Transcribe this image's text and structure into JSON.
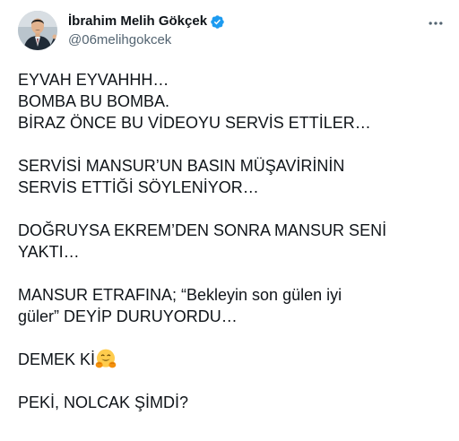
{
  "author": {
    "display_name": "İbrahim Melih Gökçek",
    "handle": "@06melihgokcek",
    "verified_icon": "verified-badge-icon",
    "avatar_icon": "profile-photo"
  },
  "menu": {
    "more_icon": "more-options-icon"
  },
  "tweet": {
    "lines": [
      "EYVAH EYVAHHH…",
      "BOMBA BU BOMBA.",
      "BİRAZ ÖNCE BU VİDEOYU SERVİS ETTİLER…",
      "",
      "SERVİSİ MANSUR’UN BASIN MÜŞAVİRİNİN",
      "SERVİS ETTİĞİ SÖYLENİYOR…",
      "",
      "DOĞRUYSA EKREM’DEN SONRA MANSUR SENİ",
      "YAKTI…",
      "",
      "MANSUR ETRAFINA; “Bekleyin son gülen iyi",
      "güler” DEYİP DURUYORDU…",
      "",
      "DEMEK Kİ",
      "",
      "PEKİ, NOLCAK ŞİMDİ?"
    ],
    "emoji": "hugging-face-emoji"
  },
  "colors": {
    "text_primary": "#0f1419",
    "text_secondary": "#536471",
    "verified_blue": "#1d9bf0",
    "emoji_yellow": "#ffcc4d"
  }
}
